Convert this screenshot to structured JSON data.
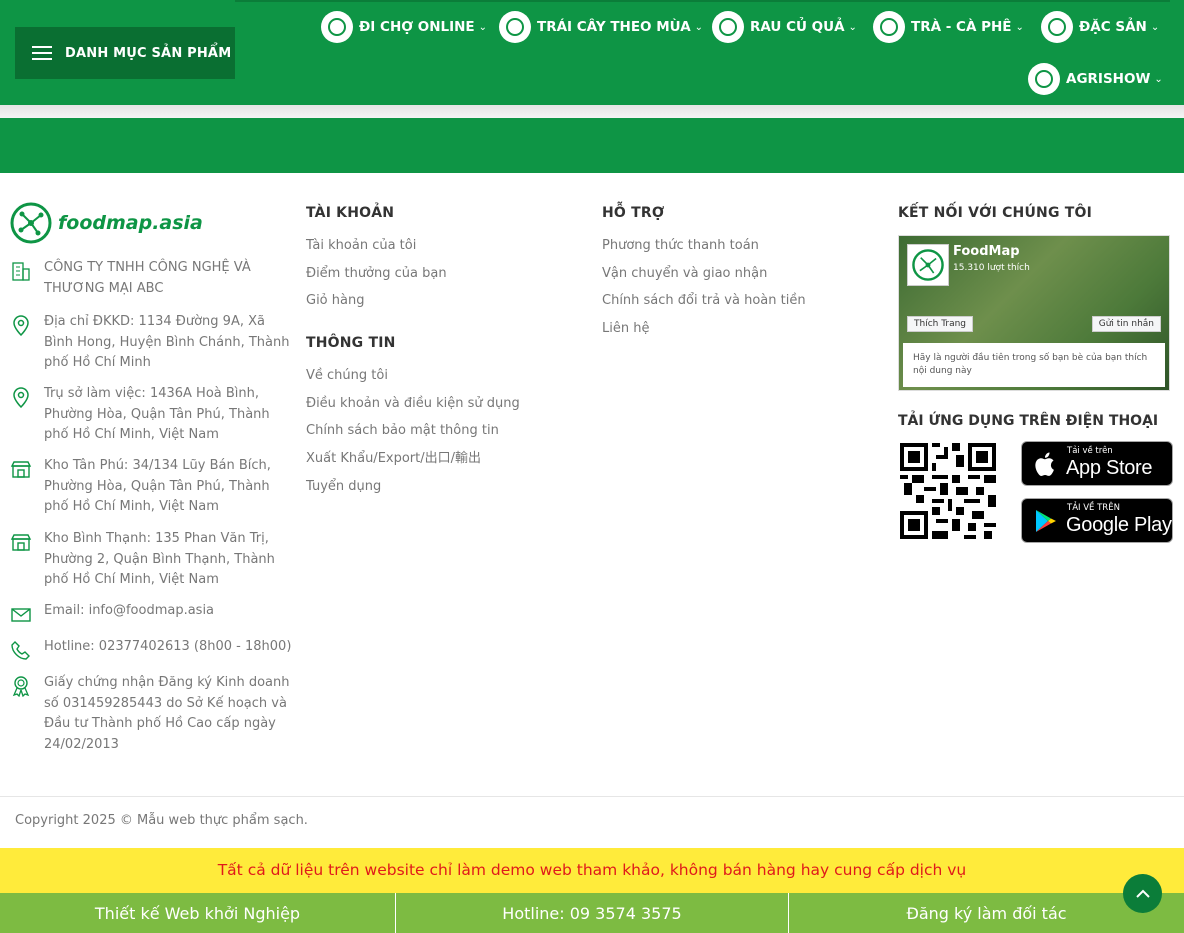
{
  "header": {
    "menu_label": "DANH MỤC SẢN PHẨM",
    "nav": [
      {
        "label": "ĐI CHỢ ONLINE",
        "icon": "basket-icon"
      },
      {
        "label": "TRÁI CÂY THEO MÙA",
        "icon": "fruit-icon"
      },
      {
        "label": "RAU CỦ QUẢ",
        "icon": "vegetable-icon"
      },
      {
        "label": "TRÀ - CÀ PHÊ",
        "icon": "tea-icon"
      },
      {
        "label": "ĐẶC SẢN",
        "icon": "specialty-icon"
      },
      {
        "label": "AGRISHOW",
        "icon": "leaf-icon"
      }
    ],
    "brand_color": "#0e9545"
  },
  "footer": {
    "logo_text": "foodmap.asia",
    "info": [
      {
        "icon": "building-icon",
        "text": "CÔNG TY TNHH CÔNG NGHỆ VÀ THƯƠNG MẠI ABC"
      },
      {
        "icon": "map-pin-icon",
        "text": "Địa chỉ ĐKKD: 1134 Đường 9A, Xã Bình Hong, Huyện Bình Chánh, Thành phố Hồ Chí Minh"
      },
      {
        "icon": "map-pin-icon",
        "text": "Trụ sở làm việc: 1436A Hoà Bình, Phường Hòa, Quận Tân Phú, Thành phố Hồ Chí Minh, Việt Nam"
      },
      {
        "icon": "store-icon",
        "text": "Kho Tân Phú: 34/134 Lũy Bán Bích, Phường Hòa, Quận Tân Phú, Thành phố Hồ Chí Minh, Việt Nam"
      },
      {
        "icon": "store-icon",
        "text": "Kho Bình Thạnh: 135 Phan Văn Trị, Phường 2, Quận Bình Thạnh, Thành phố Hồ Chí Minh, Việt Nam"
      },
      {
        "icon": "mail-icon",
        "text": "Email: info@foodmap.asia"
      },
      {
        "icon": "phone-icon",
        "text": "Hotline: 02377402613 (8h00 - 18h00)"
      },
      {
        "icon": "award-icon",
        "text": "Giấy chứng nhận Đăng ký Kinh doanh số 031459285443 do Sở Kế hoạch và Đầu tư Thành phố Hồ Cao cấp ngày 24/02/2013"
      }
    ],
    "account": {
      "title": "TÀI KHOẢN",
      "links": [
        "Tài khoản của tôi",
        "Điểm thưởng của bạn",
        "Giỏ hàng"
      ]
    },
    "information": {
      "title": "THÔNG TIN",
      "links": [
        "Về chúng tôi",
        "Điều khoản và điều kiện sử dụng",
        "Chính sách bảo mật thông tin",
        "Xuất Khẩu/Export/出口/輸出",
        "Tuyển dụng"
      ]
    },
    "support": {
      "title": "HỖ TRỢ",
      "links": [
        "Phương thức thanh toán",
        "Vận chuyển và giao nhận",
        "Chính sách đổi trả và hoàn tiền",
        "Liên hệ"
      ]
    },
    "connect": {
      "title": "KẾT NỐI VỚI CHÚNG TÔI",
      "fb_name": "FoodMap",
      "fb_likes": "15.310 lượt thích",
      "fb_like_btn": "Thích Trang",
      "fb_msg_btn": "Gửi tin nhắn",
      "fb_note": "Hãy là người đầu tiên trong số bạn bè của bạn thích nội dung này"
    },
    "apps": {
      "title": "TẢI ỨNG DỤNG TRÊN ĐIỆN THOẠI",
      "appstore_small": "Tải về trên",
      "appstore_big": "App Store",
      "googleplay_small": "TẢI VỀ TRÊN",
      "googleplay_big": "Google Play"
    },
    "copyright": "Copyright 2025 © Mẫu web thực phẩm sạch."
  },
  "notice": "Tất cả dữ liệu trên website chỉ làm demo web tham khảo, không bán hàng hay cung cấp dịch vụ",
  "bottom_bar": [
    "Thiết kế Web khởi Nghiệp",
    "Hotline: 09 3574 3575",
    "Đăng ký làm đối tác"
  ]
}
